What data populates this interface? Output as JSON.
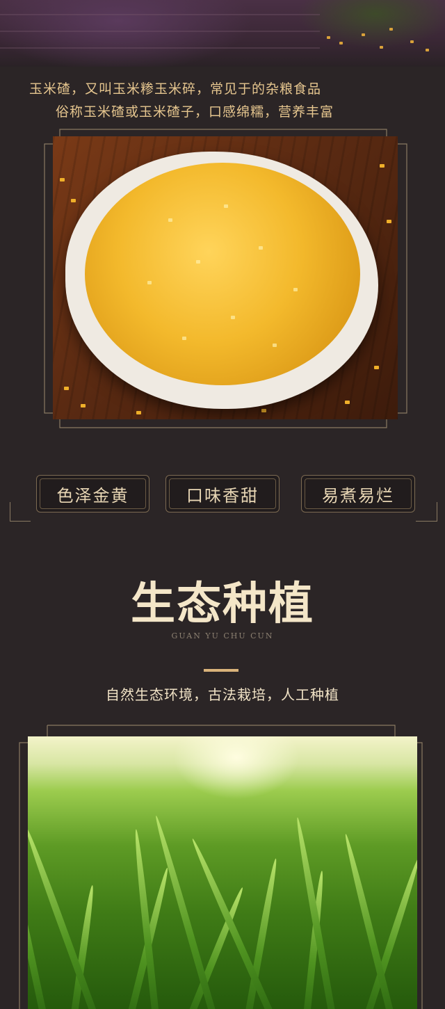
{
  "intro": {
    "line1": "玉米碴，又叫玉米糁玉米碎，常见于的杂粮食品",
    "line2": "俗称玉米碴或玉米碴子，口感绵糯，营养丰富"
  },
  "features": [
    "色泽金黄",
    "口味香甜",
    "易煮易烂"
  ],
  "section": {
    "title": "生态种植",
    "subtitle": "GUAN YU CHU CUN",
    "description": "自然生态环境，古法栽培，人工种植"
  },
  "colors": {
    "background": "#2b2526",
    "gold_text": "#e6c68f",
    "title_text": "#f4e6c8",
    "frame_line": "#8a7a62",
    "accent_bar": "#d9b37a"
  }
}
